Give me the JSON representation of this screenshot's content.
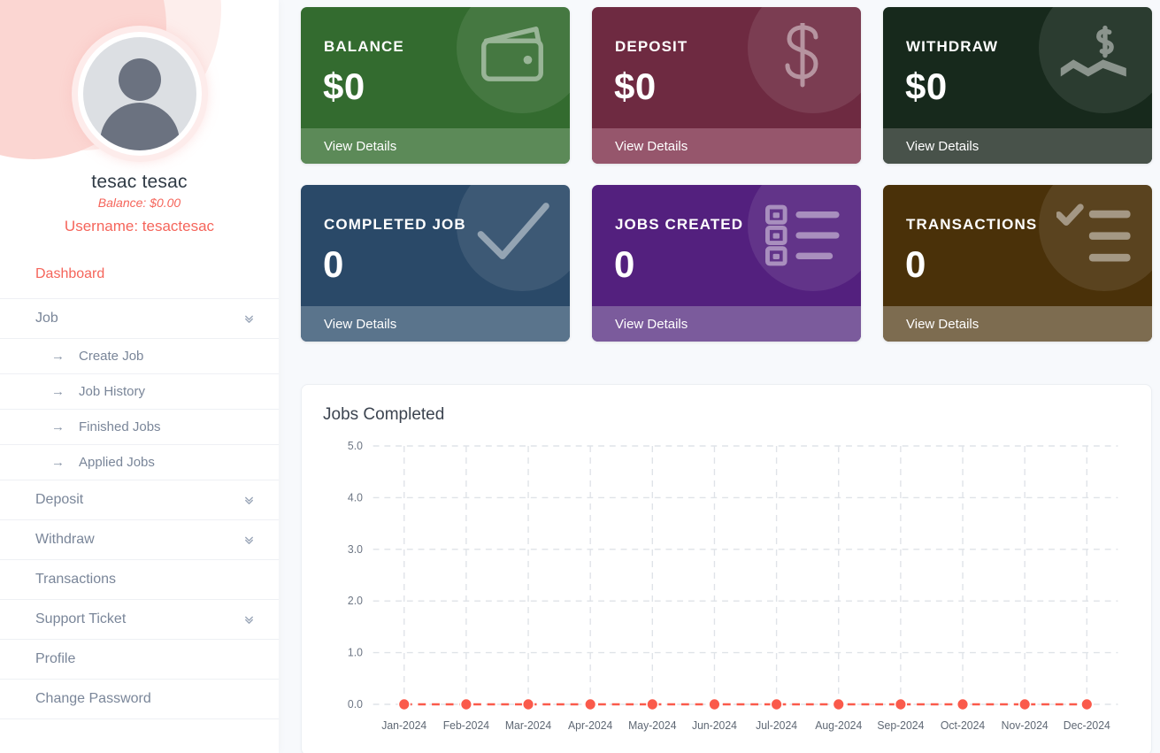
{
  "sidebar": {
    "profile": {
      "avatar_icon": "user-avatar-icon",
      "name": "tesac tesac",
      "balance": "Balance: $0.00",
      "username": "Username: tesactesac"
    },
    "nav": [
      {
        "label": "Dashboard",
        "active": true,
        "expandable": false
      },
      {
        "label": "Job",
        "active": false,
        "expandable": true,
        "children": [
          {
            "label": "Create Job"
          },
          {
            "label": "Job History"
          },
          {
            "label": "Finished Jobs"
          },
          {
            "label": "Applied Jobs"
          }
        ]
      },
      {
        "label": "Deposit",
        "active": false,
        "expandable": true
      },
      {
        "label": "Withdraw",
        "active": false,
        "expandable": true
      },
      {
        "label": "Transactions",
        "active": false,
        "expandable": false
      },
      {
        "label": "Support Ticket",
        "active": false,
        "expandable": true
      },
      {
        "label": "Profile",
        "active": false,
        "expandable": false
      },
      {
        "label": "Change Password",
        "active": false,
        "expandable": false
      }
    ],
    "chevron_icon": "chevron-double-down-icon",
    "sub_arrow_icon": "arrow-right-icon"
  },
  "cards": [
    {
      "title": "BALANCE",
      "value": "$0",
      "link": "View Details",
      "bg": "#336b2f",
      "foot_bg": "#5c8a58",
      "icon": "wallet-icon"
    },
    {
      "title": "DEPOSIT",
      "value": "$0",
      "link": "View Details",
      "bg": "#6e2a41",
      "foot_bg": "#96566c",
      "icon": "dollar-sign-icon"
    },
    {
      "title": "WITHDRAW",
      "value": "$0",
      "link": "View Details",
      "bg": "#17291c",
      "foot_bg": "#48524a",
      "icon": "money-bill-wave-icon"
    },
    {
      "title": "COMPLETED JOB",
      "value": "0",
      "link": "View Details",
      "bg": "#2a4968",
      "foot_bg": "#5a748c",
      "icon": "check-icon"
    },
    {
      "title": "JOBS CREATED",
      "value": "0",
      "link": "View Details",
      "bg": "#53207e",
      "foot_bg": "#7b5b9c",
      "icon": "list-ul-icon"
    },
    {
      "title": "TRANSACTIONS",
      "value": "0",
      "link": "View Details",
      "bg": "#4a3109",
      "foot_bg": "#7d6c50",
      "icon": "tasks-icon"
    }
  ],
  "chart_data": {
    "type": "line",
    "title": "Jobs Completed",
    "xlabel": "",
    "ylabel": "",
    "categories": [
      "Jan-2024",
      "Feb-2024",
      "Mar-2024",
      "Apr-2024",
      "May-2024",
      "Jun-2024",
      "Jul-2024",
      "Aug-2024",
      "Sep-2024",
      "Oct-2024",
      "Nov-2024",
      "Dec-2024"
    ],
    "values": [
      0,
      0,
      0,
      0,
      0,
      0,
      0,
      0,
      0,
      0,
      0,
      0
    ],
    "ytick_labels": [
      "5.0",
      "4.0",
      "3.0",
      "2.0",
      "1.0",
      "0.0"
    ],
    "ylim": [
      0,
      5
    ],
    "grid": true,
    "grid_style": "dashed",
    "legend": "none",
    "series_color": "#fa5a4b",
    "marker": "circle"
  }
}
